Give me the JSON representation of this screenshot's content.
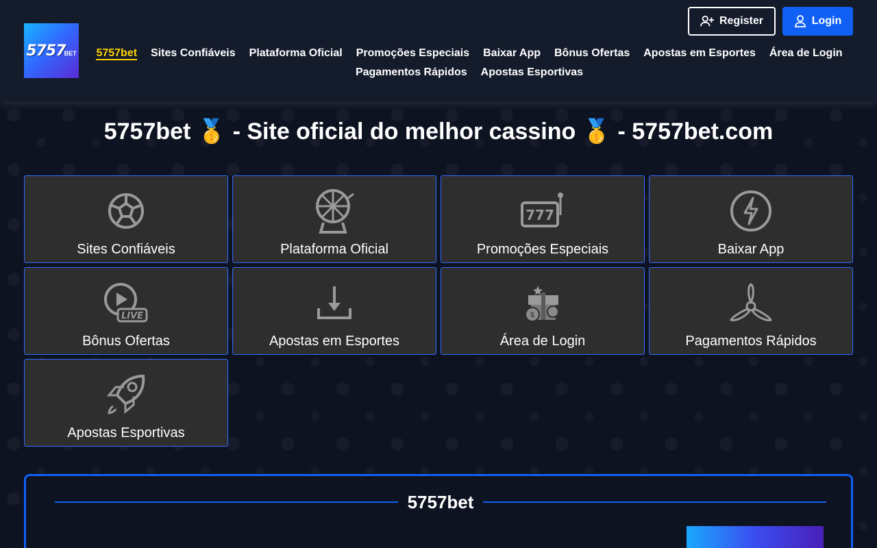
{
  "brand": {
    "logo_text": "5757",
    "logo_sub": "BET"
  },
  "auth": {
    "register_label": "Register",
    "login_label": "Login"
  },
  "nav": {
    "items": [
      "5757bet",
      "Sites Confiáveis",
      "Plataforma Oficial",
      "Promoções Especiais",
      "Baixar App",
      "Bônus Ofertas",
      "Apostas em Esportes",
      "Área de Login",
      "Pagamentos Rápidos",
      "Apostas Esportivas"
    ],
    "active_index": 0
  },
  "page_title": "5757bet 🥇 - Site oficial do melhor cassino 🥇 - 5757bet.com",
  "tiles": [
    {
      "label": "Sites Confiáveis",
      "icon": "soccer-ball-icon"
    },
    {
      "label": "Plataforma Oficial",
      "icon": "roulette-wheel-icon"
    },
    {
      "label": "Promoções Especiais",
      "icon": "slot-machine-icon"
    },
    {
      "label": "Baixar App",
      "icon": "lightning-icon"
    },
    {
      "label": "Bônus Ofertas",
      "icon": "live-play-icon"
    },
    {
      "label": "Apostas em Esportes",
      "icon": "download-icon"
    },
    {
      "label": "Área de Login",
      "icon": "gift-coins-icon"
    },
    {
      "label": "Pagamentos Rápidos",
      "icon": "propeller-icon"
    },
    {
      "label": "Apostas Esportivas",
      "icon": "rocket-icon"
    }
  ],
  "section": {
    "title": "5757bet"
  },
  "colors": {
    "accent": "#1060f6",
    "active_nav": "#ffd400",
    "tile_bg": "#2e2e2e",
    "header_bg": "#141b2b"
  }
}
